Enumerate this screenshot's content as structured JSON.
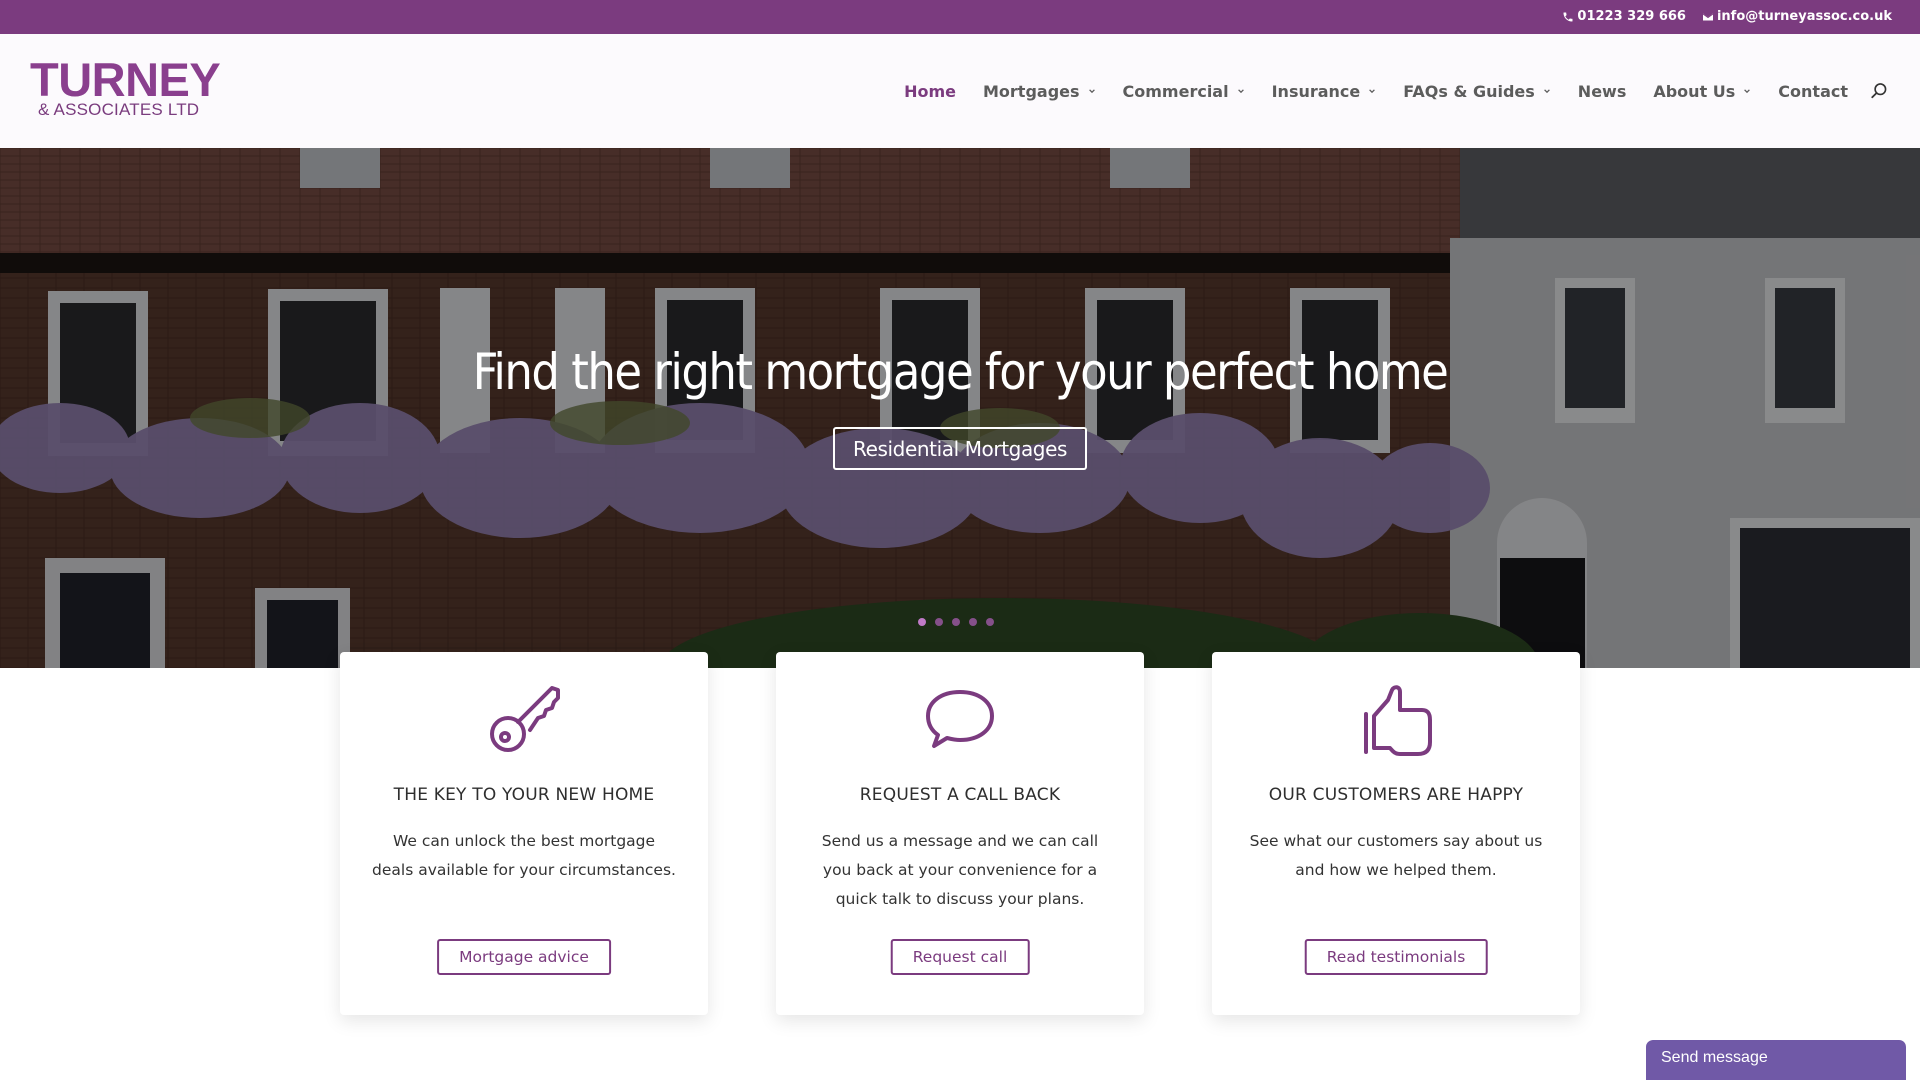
{
  "topbar": {
    "phone": "01223 329 666",
    "email": "info@turneyassoc.co.uk",
    "phone_icon": "phone-icon",
    "email_icon": "envelope-icon"
  },
  "brand": {
    "name": "TURNEY",
    "tagline": "& ASSOCIATES LTD",
    "accent": "#7b3b7f"
  },
  "nav": {
    "items": [
      {
        "label": "Home",
        "active": true,
        "dropdown": false
      },
      {
        "label": "Mortgages",
        "active": false,
        "dropdown": true
      },
      {
        "label": "Commercial",
        "active": false,
        "dropdown": true
      },
      {
        "label": "Insurance",
        "active": false,
        "dropdown": true
      },
      {
        "label": "FAQs & Guides",
        "active": false,
        "dropdown": true
      },
      {
        "label": "News",
        "active": false,
        "dropdown": false
      },
      {
        "label": "About Us",
        "active": false,
        "dropdown": true
      },
      {
        "label": "Contact",
        "active": false,
        "dropdown": false
      }
    ],
    "search_icon": "search-icon"
  },
  "hero": {
    "title": "Find the right mortgage for your perfect home",
    "button": "Residential Mortgages",
    "slides": 5,
    "active_slide": 1
  },
  "cards": [
    {
      "icon": "key-icon",
      "title": "THE KEY TO YOUR NEW HOME",
      "text": "We can unlock the best mortgage deals available for your circumstances.",
      "button": "Mortgage advice"
    },
    {
      "icon": "speech-bubble-icon",
      "title": "REQUEST A CALL BACK",
      "text": "Send us a message and we can call you back at your convenience for a quick talk to discuss your plans.",
      "button": "Request call"
    },
    {
      "icon": "thumbs-up-icon",
      "title": "OUR CUSTOMERS ARE HAPPY",
      "text": "See what our customers say about us and how we helped them.",
      "button": "Read testimonials"
    }
  ],
  "chat_widget": {
    "label": "Send message",
    "color": "#7059a7"
  }
}
